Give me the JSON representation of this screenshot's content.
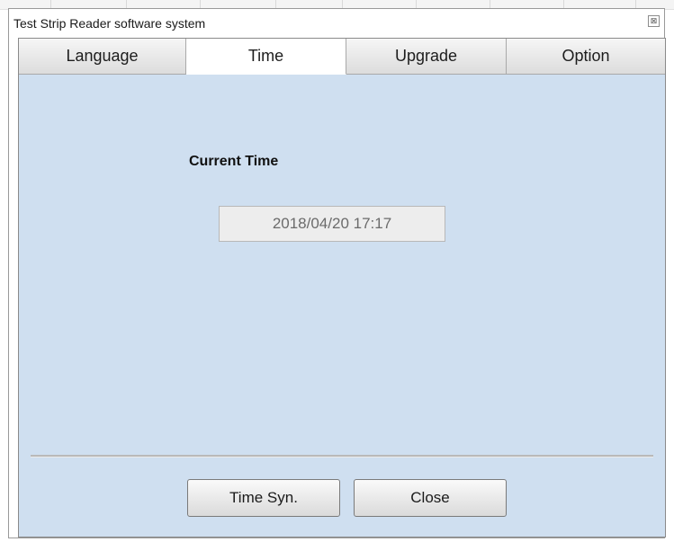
{
  "window": {
    "title": "Test Strip Reader software system",
    "close_glyph": "⊠"
  },
  "tabs": [
    {
      "label": "Language"
    },
    {
      "label": "Time",
      "active": true
    },
    {
      "label": "Upgrade"
    },
    {
      "label": "Option"
    }
  ],
  "time_panel": {
    "heading": "Current Time",
    "value": "2018/04/20 17:17"
  },
  "buttons": {
    "time_syn": "Time Syn.",
    "close": "Close"
  },
  "colors": {
    "panel_bg": "#cfdff0",
    "active_tab": "#ffffff"
  }
}
